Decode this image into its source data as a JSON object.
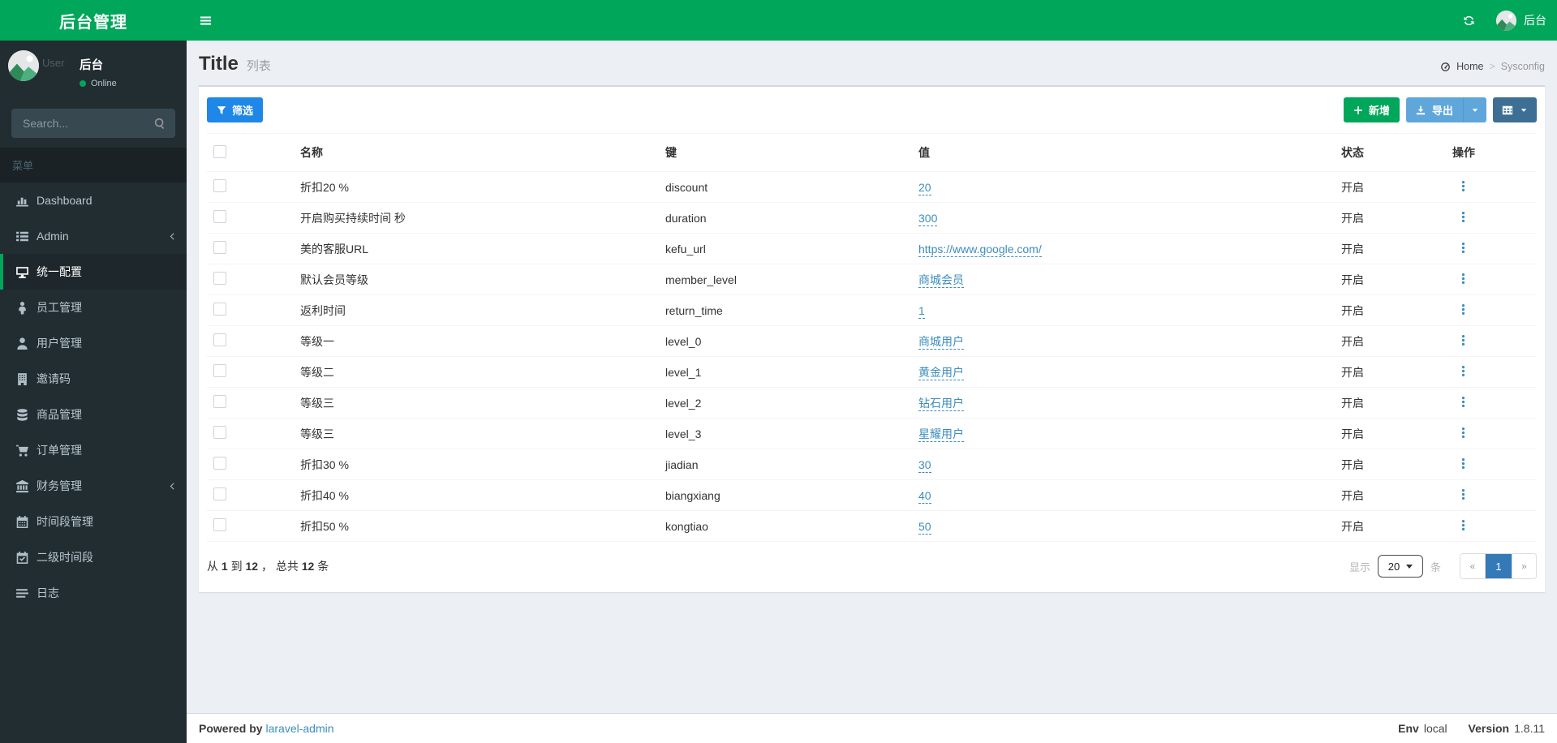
{
  "app": {
    "logo_title": "后台管理"
  },
  "navbar": {
    "user_label": "后台"
  },
  "sidebar": {
    "user": {
      "name": "后台",
      "alt": "User",
      "status": "Online"
    },
    "search_placeholder": "Search...",
    "menu_header": "菜单",
    "items": [
      {
        "id": "dashboard",
        "label": "Dashboard",
        "icon": "bar-chart"
      },
      {
        "id": "admin",
        "label": "Admin",
        "icon": "list",
        "chevron": true
      },
      {
        "id": "sysconfig",
        "label": "统一配置",
        "icon": "desktop",
        "active": true
      },
      {
        "id": "staff",
        "label": "员工管理",
        "icon": "child"
      },
      {
        "id": "users",
        "label": "用户管理",
        "icon": "user"
      },
      {
        "id": "invite",
        "label": "邀请码",
        "icon": "building"
      },
      {
        "id": "goods",
        "label": "商品管理",
        "icon": "database"
      },
      {
        "id": "orders",
        "label": "订单管理",
        "icon": "cart"
      },
      {
        "id": "finance",
        "label": "财务管理",
        "icon": "bank",
        "chevron": true
      },
      {
        "id": "timeslot",
        "label": "时间段管理",
        "icon": "calendar"
      },
      {
        "id": "timeslot2",
        "label": "二级时间段",
        "icon": "calendar-check"
      },
      {
        "id": "logs",
        "label": "日志",
        "icon": "logs"
      }
    ]
  },
  "page": {
    "title": "Title",
    "subtitle": "列表",
    "breadcrumb": {
      "home": "Home",
      "separator": ">",
      "current": "Sysconfig"
    }
  },
  "toolbar": {
    "filter": "筛选",
    "create": "新增",
    "export": "导出"
  },
  "table": {
    "headers": [
      "名称",
      "键",
      "值",
      "状态",
      "操作"
    ],
    "rows": [
      {
        "name": "折扣20 %",
        "key": "discount",
        "value": "20",
        "status": "开启"
      },
      {
        "name": "开启购买持续时间 秒",
        "key": "duration",
        "value": "300",
        "status": "开启"
      },
      {
        "name": "美的客服URL",
        "key": "kefu_url",
        "value": "https://www.google.com/",
        "status": "开启"
      },
      {
        "name": "默认会员等级",
        "key": "member_level",
        "value": "商城会员",
        "status": "开启"
      },
      {
        "name": "返利时间",
        "key": "return_time",
        "value": "1",
        "status": "开启"
      },
      {
        "name": "等级一",
        "key": "level_0",
        "value": "商城用户",
        "status": "开启"
      },
      {
        "name": "等级二",
        "key": "level_1",
        "value": "黄金用户",
        "status": "开启"
      },
      {
        "name": "等级三",
        "key": "level_2",
        "value": "钻石用户",
        "status": "开启"
      },
      {
        "name": "等级三",
        "key": "level_3",
        "value": "星耀用户",
        "status": "开启"
      },
      {
        "name": "折扣30 %",
        "key": "jiadian",
        "value": "30",
        "status": "开启"
      },
      {
        "name": "折扣40 %",
        "key": "biangxiang",
        "value": "40",
        "status": "开启"
      },
      {
        "name": "折扣50 %",
        "key": "kongtiao",
        "value": "50",
        "status": "开启"
      }
    ],
    "summary": {
      "text_from": "从",
      "from": "1",
      "text_to": "到",
      "to": "12",
      "comma": "，",
      "text_total": "总共",
      "total": "12",
      "unit": "条"
    }
  },
  "pagination": {
    "show_label": "显示",
    "per_page": "20",
    "unit": "条",
    "prev": "«",
    "page": "1",
    "next": "»"
  },
  "footer": {
    "powered_label": "Powered by",
    "powered_link": "laravel-admin",
    "env_label": "Env",
    "env_value": "local",
    "version_label": "Version",
    "version_value": "1.8.11"
  },
  "icons": {
    "hamburger-icon": "three horizontal bars",
    "refresh-icon": "circular arrows",
    "search-icon": "magnifier",
    "filter-icon": "funnel",
    "plus-icon": "plus sign",
    "download-icon": "arrow into tray",
    "grid-icon": "table grid",
    "caret-down-icon": "small down triangle",
    "chevron-left-icon": "thin left angle",
    "dashboard-gauge-icon": "speedometer",
    "ellipsis-v-icon": "vertical three dots"
  },
  "colors": {
    "brand_green": "#00a65a",
    "sidebar_dark": "#222d32",
    "sidebar_active_bg": "#1e282c",
    "content_bg": "#ecf0f5",
    "link_blue": "#3c8dbc",
    "filter_blue": "#1e87e8",
    "export_blue": "#5fa7db",
    "grid_slate": "#3d6e93",
    "pagination_active": "#337ab7"
  }
}
